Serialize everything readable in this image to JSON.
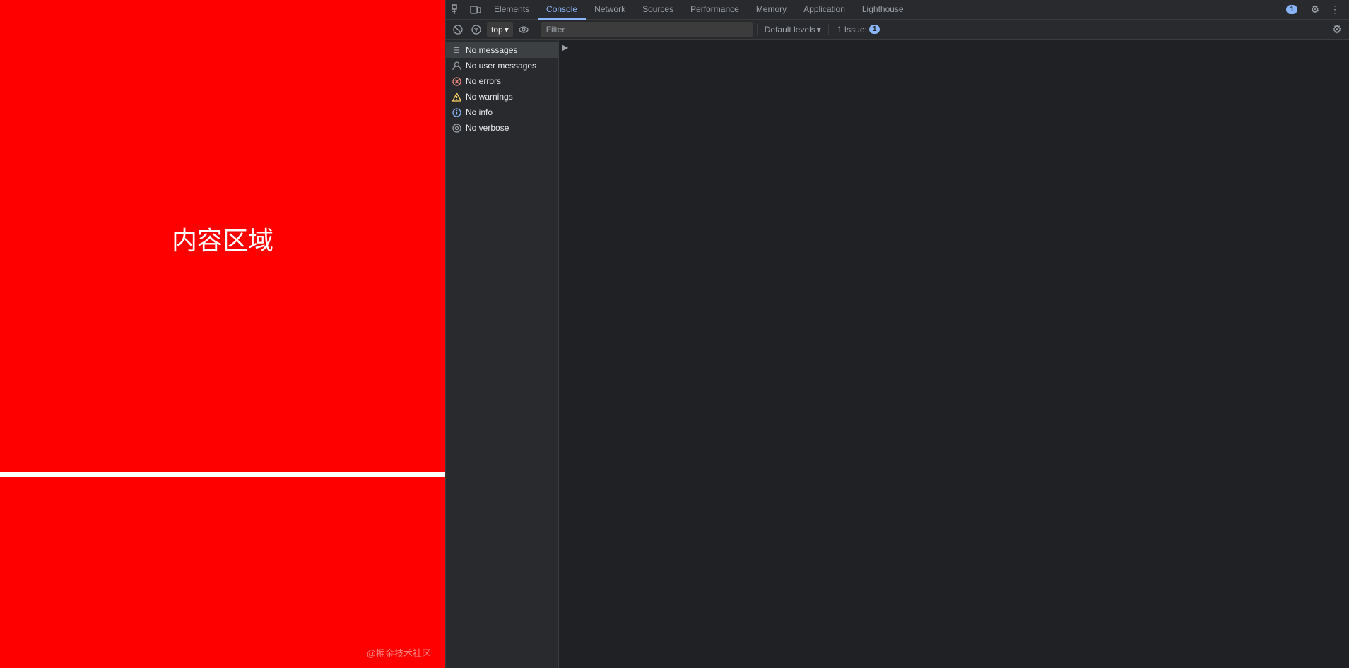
{
  "page": {
    "content_text": "内容区域",
    "attribution": "@掘金技术社区"
  },
  "devtools": {
    "tabs": [
      {
        "id": "elements",
        "label": "Elements",
        "active": false
      },
      {
        "id": "console",
        "label": "Console",
        "active": true
      },
      {
        "id": "network",
        "label": "Network",
        "active": false
      },
      {
        "id": "sources",
        "label": "Sources",
        "active": false
      },
      {
        "id": "performance",
        "label": "Performance",
        "active": false
      },
      {
        "id": "memory",
        "label": "Memory",
        "active": false
      },
      {
        "id": "application",
        "label": "Application",
        "active": false
      },
      {
        "id": "lighthouse",
        "label": "Lighthouse",
        "active": false
      }
    ],
    "toolbar": {
      "inspect_icon": "⊡",
      "device_icon": "▭",
      "more_icon": "⋮",
      "badge_count": "1",
      "settings_icon": "⚙"
    },
    "console_toolbar": {
      "clear_icon": "🚫",
      "top_label": "top",
      "eye_icon": "👁",
      "filter_placeholder": "Filter",
      "default_levels_label": "Default levels",
      "issue_label": "1 Issue:",
      "issue_count": "1"
    },
    "sidebar": {
      "items": [
        {
          "id": "messages",
          "label": "No messages",
          "icon_type": "messages"
        },
        {
          "id": "user",
          "label": "No user messages",
          "icon_type": "user"
        },
        {
          "id": "errors",
          "label": "No errors",
          "icon_type": "error"
        },
        {
          "id": "warnings",
          "label": "No warnings",
          "icon_type": "warning"
        },
        {
          "id": "info",
          "label": "No info",
          "icon_type": "info"
        },
        {
          "id": "verbose",
          "label": "No verbose",
          "icon_type": "verbose"
        }
      ]
    }
  },
  "colors": {
    "red": "#ff0000",
    "devtools_bg": "#202124",
    "devtools_toolbar": "#292a2d"
  }
}
